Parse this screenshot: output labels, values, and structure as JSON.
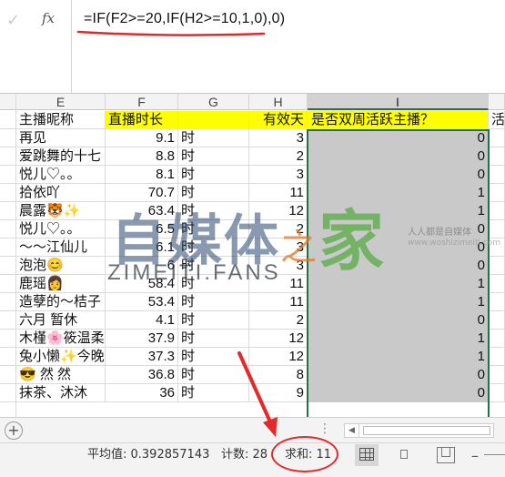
{
  "formula_bar": {
    "check_icon": "check-icon",
    "fx_label": "fx",
    "formula": "=IF(F2>=20,IF(H2>=10,1,0),0)"
  },
  "columns": [
    "E",
    "F",
    "G",
    "H",
    "I",
    "J"
  ],
  "header_row": {
    "e": "主播昵称",
    "f": "直播时长",
    "g": "",
    "h": "有效天",
    "i": "是否双周活跃主播？",
    "j": "活"
  },
  "rows": [
    {
      "e": "再见",
      "f": "9.1",
      "g": "时",
      "h": "3",
      "i": "0"
    },
    {
      "e": "爱跳舞的十七",
      "f": "8.8",
      "g": "时",
      "h": "2",
      "i": "0"
    },
    {
      "e": "悦儿♡。。",
      "f": "8.1",
      "g": "时",
      "h": "3",
      "i": "0"
    },
    {
      "e": "拾依吖",
      "f": "70.7",
      "g": "时",
      "h": "11",
      "i": "1"
    },
    {
      "e": "晨露🐯✨",
      "f": "63.4",
      "g": "时",
      "h": "12",
      "i": "1"
    },
    {
      "e": "悦儿♡。。",
      "f": "6.5",
      "g": "时",
      "h": "2",
      "i": "0"
    },
    {
      "e": "～～江仙儿",
      "f": "6.1",
      "g": "时",
      "h": "3",
      "i": "0"
    },
    {
      "e": "泡泡😊",
      "f": "6",
      "g": "时",
      "h": "3",
      "i": "0"
    },
    {
      "e": "鹿瑶👩",
      "f": "58.4",
      "g": "时",
      "h": "11",
      "i": "1"
    },
    {
      "e": "造孽的～桔子",
      "f": "53.4",
      "g": "时",
      "h": "11",
      "i": "1"
    },
    {
      "e": "六月 暂休",
      "f": "4.1",
      "g": "时",
      "h": "2",
      "i": "0"
    },
    {
      "e": "木槿🌸筱温柔",
      "f": "37.9",
      "g": "时",
      "h": "12",
      "i": "1"
    },
    {
      "e": "兔小懒✨今晚",
      "f": "37.3",
      "g": "时",
      "h": "12",
      "i": "1"
    },
    {
      "e": "😎 然 然",
      "f": "36.8",
      "g": "时",
      "h": "8",
      "i": "0"
    },
    {
      "e": "抹茶、沐沐",
      "f": "36",
      "g": "时",
      "h": "9",
      "i": "0"
    }
  ],
  "watermark": {
    "cn": "自媒体",
    "mid": "之",
    "jia": "家",
    "en": "ZIMEITI.FANS",
    "small1": "人人都是自媒体",
    "small2": "www.woshizimeiti.com"
  },
  "sheet_tabs": {
    "add_icon": "plus-icon",
    "dots": "⋮"
  },
  "status_bar": {
    "average": "平均值: 0.392857143",
    "count": "计数: 28",
    "sum": "求和: 11"
  },
  "colors": {
    "header_yellow": "#ffff00",
    "selection_green": "#217346",
    "annotation_red": "#e5282a"
  }
}
